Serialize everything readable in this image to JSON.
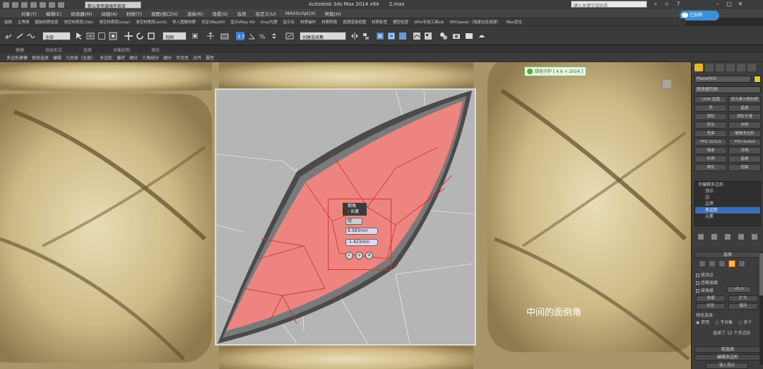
{
  "title_bar": {
    "workspace": "默认使用增强型菜单",
    "app_title": "Autodesk 3ds Max  2014 x64",
    "file_name": "2.max",
    "search_placeholder": "键入关键字或短语"
  },
  "menu": [
    "对象(Y)",
    "编辑(E)",
    "修改器(M)",
    "动画(A)",
    "材质(T)",
    "视图/视口(V)",
    "渲染(R)",
    "场景(S)",
    "选项",
    "自定义(U)",
    "MAXScript(X)",
    "帮助(H)"
  ],
  "cloud_label": "已加网",
  "plugins": [
    "选择",
    "主界面",
    "超前材质信息",
    "清空材质库(3ds)",
    "清空材质库(vray)",
    "清空材质库(arch)",
    "导入图像材质",
    "灵定VRayAO",
    "显示VRay AO",
    "Vray代理",
    "显示名",
    "材质操作",
    "材质转换",
    "真理渲染视图",
    "材质标签",
    "模型检查",
    "dPro专用工具Lib",
    "SPCleaner（场景垃圾清理）",
    "Max优化"
  ],
  "toolbar": {
    "filter_all": "全部",
    "view_select": "视图",
    "named_select": "创建选择集"
  },
  "ribbon_tabs": [
    "建模",
    "自由形式",
    "选择",
    "对象绘制",
    "填充"
  ],
  "ribbon_items": [
    "多边形建模",
    "修改选择",
    "编辑",
    "几何体（全部）",
    "多边形",
    "循环",
    "细分",
    "三角剖分",
    "细分",
    "可见性",
    "对齐",
    "属性"
  ],
  "viewport": {
    "badge": "绿色守护 [ 4.6 + 2014 ]",
    "caption": "中间的面倒角",
    "caddy": {
      "title_line1": "倒角",
      "title_line2": "- 长度",
      "select_value": "组",
      "height_value": "8.583mm",
      "outline_value": "-1.423mm",
      "btn_ok": "✓",
      "btn_apply": "+",
      "btn_cancel": "✕"
    }
  },
  "panel": {
    "object_name": "Plane003",
    "modifier_list": "修改器列表",
    "modifiers": [
      [
        "UVW 贴图",
        "按元素分配材质"
      ],
      [
        "壳",
        "晶格"
      ],
      [
        "涡轮",
        "涡轮平滑"
      ],
      [
        "挤出",
        "车削"
      ],
      [
        "弯曲",
        "编辑多边形"
      ],
      [
        "FFD 3x3x3",
        "FFD 4x4x4"
      ],
      [
        "噪波",
        "法线"
      ],
      [
        "补洞",
        "晶格"
      ],
      [
        "锥化",
        "扭曲"
      ]
    ],
    "stack": [
      "可编辑多边形",
      "顶点",
      "边",
      "边界",
      "多边形",
      "元素"
    ],
    "stack_selected_index": 4,
    "rollout_selection": "选择",
    "opt_by_vertex": "按顶点",
    "opt_ignore_back": "忽略背面",
    "opt_by_angle": "按角度",
    "angle_value": "45.0",
    "btn_shrink": "收缩",
    "btn_grow": "扩大",
    "btn_ring": "环形",
    "btn_loop": "循环",
    "preview_label": "预览选择",
    "preview_off": "禁用",
    "preview_sub": "子对象",
    "preview_multi": "多个",
    "selection_info": "选择了 12 个多边形",
    "rollout_soft": "软选择",
    "rollout_edit": "编辑多边形",
    "insert_vertex": "插入顶点"
  }
}
